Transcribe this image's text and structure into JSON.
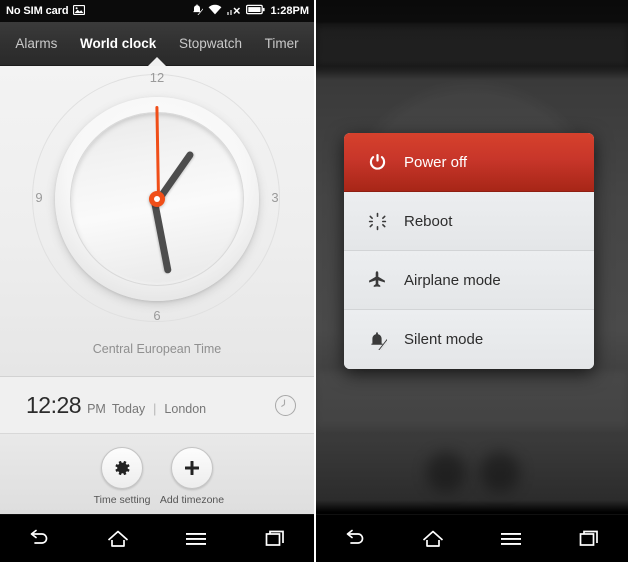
{
  "left_screen": {
    "status_bar": {
      "carrier_text": "No SIM card",
      "photo_icon": "photo-icon",
      "silent_icon": "silent-mode-icon",
      "wifi_icon": "wifi-icon",
      "signal_icon": "no-signal-icon",
      "battery_icon": "battery-icon",
      "time": "1:28PM"
    },
    "tabs": [
      {
        "label": "Alarms",
        "active": false
      },
      {
        "label": "World clock",
        "active": true
      },
      {
        "label": "Stopwatch",
        "active": false
      },
      {
        "label": "Timer",
        "active": false
      }
    ],
    "clock": {
      "numerals": {
        "top": "12",
        "right": "3",
        "bottom": "6",
        "left": "9"
      },
      "timezone_label": "Central European Time",
      "hour_hand_deg": -55,
      "minute_hand_deg": 79,
      "second_hand_deg": -91,
      "accent_color": "#f04e18",
      "hand_color": "#4d4d4d"
    },
    "time_row": {
      "time": "12:28",
      "meridiem": "PM",
      "day": "Today",
      "separator": "|",
      "city": "London",
      "badge_icon": "clock-icon"
    },
    "actions": [
      {
        "label": "Time setting",
        "icon": "gear-icon"
      },
      {
        "label": "Add timezone",
        "icon": "plus-icon"
      }
    ],
    "nav_bar": [
      {
        "name": "back-button",
        "icon": "back-arrow-icon"
      },
      {
        "name": "home-button",
        "icon": "home-icon"
      },
      {
        "name": "menu-button",
        "icon": "menu-icon"
      },
      {
        "name": "recents-button",
        "icon": "recents-icon"
      }
    ]
  },
  "right_screen": {
    "power_menu": {
      "items": [
        {
          "label": "Power off",
          "icon": "power-icon",
          "highlight": true,
          "color": "#c8362a"
        },
        {
          "label": "Reboot",
          "icon": "reboot-icon",
          "highlight": false
        },
        {
          "label": "Airplane mode",
          "icon": "airplane-icon",
          "highlight": false
        },
        {
          "label": "Silent mode",
          "icon": "silent-bell-icon",
          "highlight": false
        }
      ]
    },
    "nav_bar": [
      {
        "name": "back-button",
        "icon": "back-arrow-icon"
      },
      {
        "name": "home-button",
        "icon": "home-icon"
      },
      {
        "name": "menu-button",
        "icon": "menu-icon"
      },
      {
        "name": "recents-button",
        "icon": "recents-icon"
      }
    ]
  }
}
